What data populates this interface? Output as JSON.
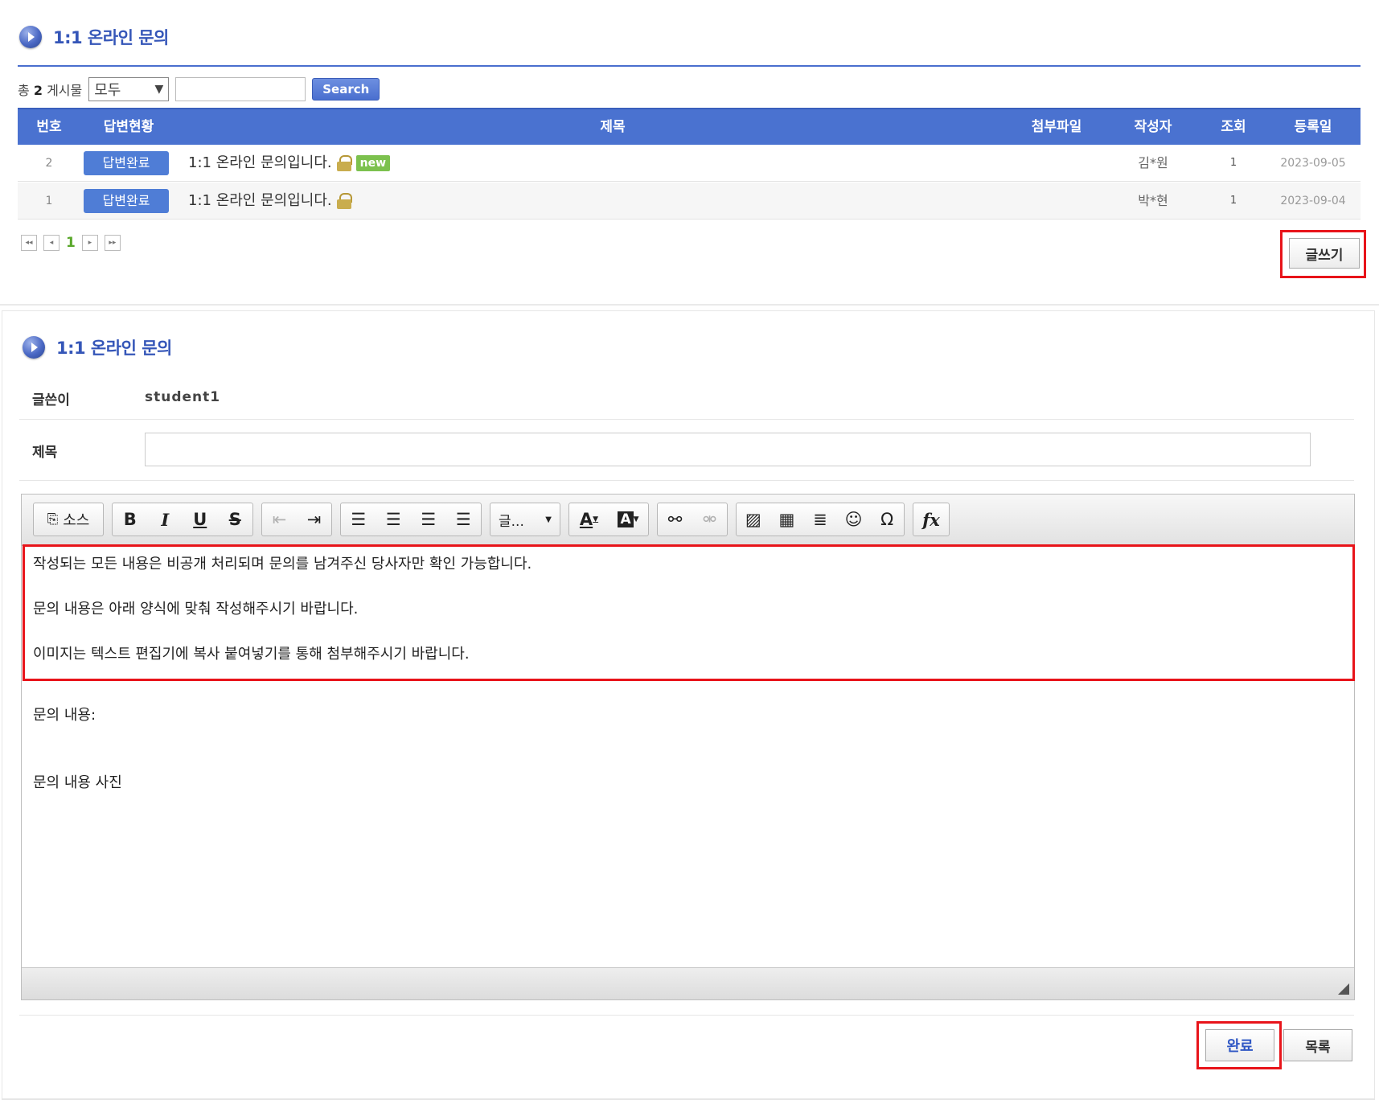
{
  "board": {
    "title": "1:1 온라인 문의",
    "total_prefix": "총",
    "total_count": "2",
    "total_suffix": "게시물",
    "filter_value": "모두",
    "search_label": "Search",
    "columns": [
      "번호",
      "답변현황",
      "제목",
      "첨부파일",
      "작성자",
      "조회",
      "등록일"
    ],
    "rows": [
      {
        "no": "2",
        "status": "답변완료",
        "subject": "1:1 온라인 문의입니다.",
        "badge": "new",
        "author": "김*원",
        "views": "1",
        "date": "2023-09-05"
      },
      {
        "no": "1",
        "status": "답변완료",
        "subject": "1:1 온라인 문의입니다.",
        "badge": "",
        "author": "박*현",
        "views": "1",
        "date": "2023-09-04"
      }
    ],
    "pagination": {
      "first": "◂◂",
      "prev": "◂",
      "current": "1",
      "next": "▸",
      "last": "▸▸"
    },
    "write_button": "글쓰기"
  },
  "form": {
    "title": "1:1 온라인 문의",
    "author_label": "글쓴이",
    "author_value": "student1",
    "subject_label": "제목",
    "subject_value": "",
    "editor": {
      "source_label": "소스",
      "bold": "B",
      "italic": "I",
      "underline": "U",
      "strike": "S",
      "font_label": "글...",
      "lines": [
        "작성되는 모든 내용은 비공개 처리되며 문의를 남겨주신 당사자만 확인 가능합니다.",
        "문의 내용은 아래 양식에 맞춰 작성해주시기 바랍니다.",
        "이미지는 텍스트 편집기에 복사 붙여넣기를 통해 첨부해주시기 바랍니다.",
        "문의 내용:",
        "문의 내용 사진"
      ]
    },
    "done_button": "완료",
    "list_button": "목록"
  },
  "colors": {
    "accent": "#4a72d0",
    "highlight": "#e8141a",
    "status_badge": "#4f7dd6",
    "new_badge": "#7cc14e"
  }
}
